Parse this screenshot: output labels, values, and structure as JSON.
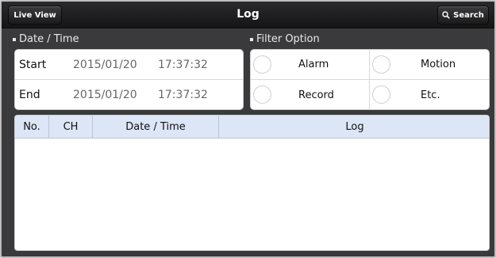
{
  "header": {
    "live_view_label": "Live View",
    "title": "Log",
    "search_label": "Search",
    "search_icon": "magnifier-icon"
  },
  "date_time": {
    "section_label": "Date / Time",
    "start": {
      "label": "Start",
      "date": "2015/01/20",
      "time": "17:37:32"
    },
    "end": {
      "label": "End",
      "date": "2015/01/20",
      "time": "17:37:32"
    }
  },
  "filter": {
    "section_label": "Filter Option",
    "options": [
      {
        "label": "Alarm",
        "selected": false
      },
      {
        "label": "Motion",
        "selected": false
      },
      {
        "label": "Record",
        "selected": false
      },
      {
        "label": "Etc.",
        "selected": false
      }
    ]
  },
  "log_table": {
    "columns": [
      "No.",
      "CH",
      "Date / Time",
      "Log"
    ],
    "rows": []
  },
  "colors": {
    "topbar": "#1c1c1e",
    "frame": "#3a3a3c",
    "table_header": "#dde6f6"
  }
}
